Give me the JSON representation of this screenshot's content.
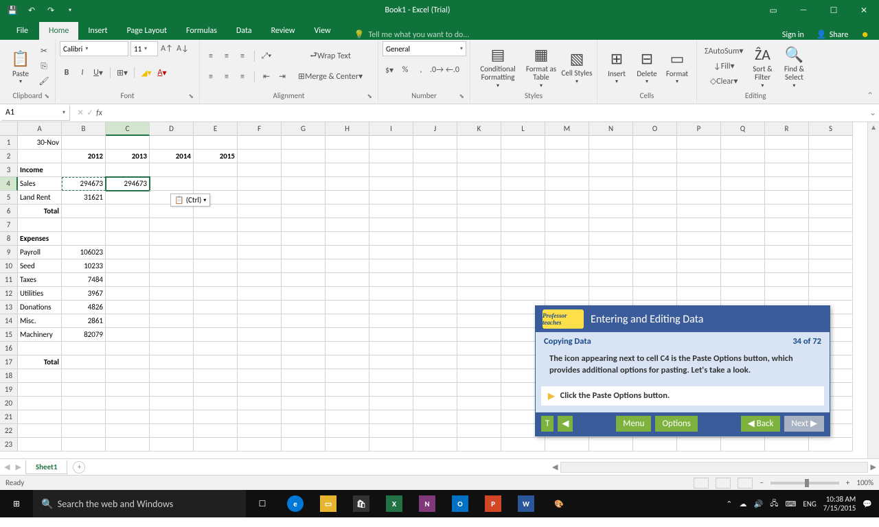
{
  "window": {
    "title": "Book1 - Excel (Trial)"
  },
  "tabs": {
    "file": "File",
    "items": [
      "Home",
      "Insert",
      "Page Layout",
      "Formulas",
      "Data",
      "Review",
      "View"
    ],
    "active_index": 0,
    "tellme": "Tell me what you want to do...",
    "sign_in": "Sign in",
    "share": "Share"
  },
  "ribbon": {
    "clipboard": {
      "label": "Clipboard",
      "paste": "Paste"
    },
    "font": {
      "label": "Font",
      "name": "Calibri",
      "size": "11"
    },
    "alignment": {
      "label": "Alignment",
      "wrap": "Wrap Text",
      "merge": "Merge & Center"
    },
    "number": {
      "label": "Number",
      "format": "General"
    },
    "styles": {
      "label": "Styles",
      "cond": "Conditional Formatting",
      "table": "Format as Table",
      "cell": "Cell Styles"
    },
    "cells": {
      "label": "Cells",
      "insert": "Insert",
      "delete": "Delete",
      "format": "Format"
    },
    "editing": {
      "label": "Editing",
      "autosum": "AutoSum",
      "fill": "Fill",
      "clear": "Clear",
      "sort": "Sort & Filter",
      "find": "Find & Select"
    }
  },
  "namebox": "A1",
  "columns": [
    "A",
    "B",
    "C",
    "D",
    "E",
    "F",
    "G",
    "H",
    "I",
    "J",
    "K",
    "L",
    "M",
    "N",
    "O",
    "P",
    "Q",
    "R",
    "S"
  ],
  "rows": 23,
  "sel": {
    "col": 2,
    "row": 3
  },
  "cell_data": {
    "1": {
      "A": {
        "v": "30-Nov",
        "a": "r"
      }
    },
    "2": {
      "B": {
        "v": "2012",
        "a": "r",
        "b": 1
      },
      "C": {
        "v": "2013",
        "a": "r",
        "b": 1
      },
      "D": {
        "v": "2014",
        "a": "r",
        "b": 1
      },
      "E": {
        "v": "2015",
        "a": "r",
        "b": 1
      }
    },
    "3": {
      "A": {
        "v": "Income",
        "b": 1
      }
    },
    "4": {
      "A": {
        "v": "Sales"
      },
      "B": {
        "v": "294673",
        "a": "r",
        "m": 1
      },
      "C": {
        "v": "294673",
        "a": "r",
        "s": 1
      }
    },
    "5": {
      "A": {
        "v": "Land Rent"
      },
      "B": {
        "v": "31621",
        "a": "r"
      }
    },
    "6": {
      "A": {
        "v": "Total",
        "a": "r",
        "b": 1
      }
    },
    "8": {
      "A": {
        "v": "Expenses",
        "b": 1
      }
    },
    "9": {
      "A": {
        "v": "Payroll"
      },
      "B": {
        "v": "106023",
        "a": "r"
      }
    },
    "10": {
      "A": {
        "v": "Seed"
      },
      "B": {
        "v": "10233",
        "a": "r"
      }
    },
    "11": {
      "A": {
        "v": "Taxes"
      },
      "B": {
        "v": "7484",
        "a": "r"
      }
    },
    "12": {
      "A": {
        "v": "Utilities"
      },
      "B": {
        "v": "3967",
        "a": "r"
      }
    },
    "13": {
      "A": {
        "v": "Donations"
      },
      "B": {
        "v": "4826",
        "a": "r"
      }
    },
    "14": {
      "A": {
        "v": "Misc."
      },
      "B": {
        "v": "2861",
        "a": "r"
      }
    },
    "15": {
      "A": {
        "v": "Machinery"
      },
      "B": {
        "v": "82079",
        "a": "r"
      }
    },
    "17": {
      "A": {
        "v": "Total",
        "a": "r",
        "b": 1
      }
    }
  },
  "paste_options": "(Ctrl)",
  "sheet": {
    "tab": "Sheet1"
  },
  "status": {
    "ready": "Ready",
    "zoom": "100%"
  },
  "overlay": {
    "title": "Entering and Editing Data",
    "subtitle": "Copying Data",
    "progress": "34 of 72",
    "body": "The icon appearing next to cell C4 is the Paste Options button, which provides additional options for pasting. Let's take a look.",
    "action": "Click the Paste Options button.",
    "logo": "Professor teaches",
    "menu": "Menu",
    "options": "Options",
    "back": "◀ Back",
    "next": "Next ▶"
  },
  "taskbar": {
    "search": "Search the web and Windows",
    "lang": "ENG",
    "time": "10:38 AM",
    "date": "7/15/2015"
  }
}
